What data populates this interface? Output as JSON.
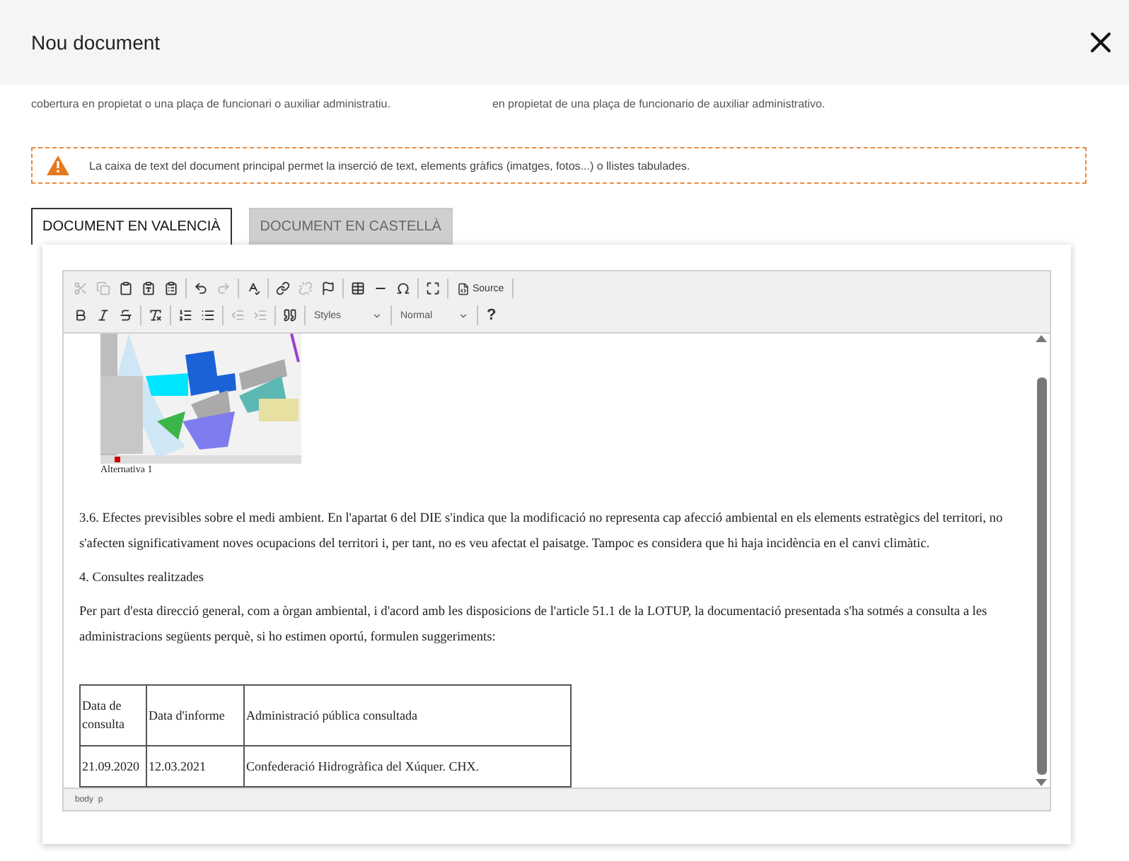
{
  "dialog": {
    "title": "Nou document"
  },
  "background_lines": [
    "cobertura en propietat o una plaça de funcionari o auxiliar administratiu.",
    "en propietat de una plaça de funcionario de auxiliar administrativo."
  ],
  "notice": "La caixa de text del document principal permet la inserció de text, elements gràfics (imatges, fotos...) o llistes tabulades.",
  "tabs": [
    {
      "label": "DOCUMENT EN VALENCIÀ",
      "selected": true
    },
    {
      "label": "DOCUMENT EN CASTELLÀ",
      "selected": false
    }
  ],
  "editor": {
    "toolbar_rows": [
      [
        {
          "kind": "icon",
          "disabled": true
        },
        {
          "kind": "icon",
          "disabled": true
        },
        {
          "kind": "icon",
          "disabled": false
        },
        {
          "kind": "icon",
          "disabled": false
        },
        {
          "kind": "icon",
          "disabled": false
        },
        {
          "kind": "sep"
        },
        {
          "kind": "icon",
          "disabled": false
        },
        {
          "kind": "icon",
          "disabled": true
        },
        {
          "kind": "sep"
        },
        {
          "kind": "icon",
          "disabled": false
        },
        {
          "kind": "sep"
        },
        {
          "kind": "icon",
          "disabled": false
        },
        {
          "kind": "icon",
          "disabled": true
        },
        {
          "kind": "icon",
          "disabled": false
        },
        {
          "kind": "sep"
        },
        {
          "kind": "icon",
          "disabled": false
        },
        {
          "kind": "icon",
          "disabled": false
        },
        {
          "kind": "icon",
          "disabled": false
        },
        {
          "kind": "sep"
        },
        {
          "kind": "icon",
          "disabled": false
        },
        {
          "kind": "sep"
        },
        {
          "kind": "source",
          "label": "Source"
        },
        {
          "kind": "sep"
        }
      ],
      [
        {
          "kind": "icon",
          "disabled": false
        },
        {
          "kind": "icon",
          "disabled": false
        },
        {
          "kind": "icon",
          "disabled": false
        },
        {
          "kind": "sep"
        },
        {
          "kind": "icon",
          "disabled": false
        },
        {
          "kind": "sep"
        },
        {
          "kind": "icon",
          "disabled": false
        },
        {
          "kind": "icon",
          "disabled": false
        },
        {
          "kind": "sep"
        },
        {
          "kind": "icon",
          "disabled": true
        },
        {
          "kind": "icon",
          "disabled": true
        },
        {
          "kind": "sep"
        },
        {
          "kind": "icon",
          "disabled": false
        },
        {
          "kind": "sep"
        },
        {
          "kind": "combo",
          "label": "Styles"
        },
        {
          "kind": "sep"
        },
        {
          "kind": "combo",
          "label": "Normal"
        },
        {
          "kind": "sep"
        },
        {
          "kind": "help",
          "label": "?"
        }
      ]
    ],
    "figure_caption": "Alternativa 1",
    "blocks": [
      {
        "kind": "paragraph",
        "text": "3.6. Efectes previsibles sobre el medi ambient. En l'apartat 6 del DIE s'indica que la modificació no representa cap afecció ambiental en els elements estratègics del territori, no s'afecten significativament noves ocupacions del territori i, per tant, no es veu afectat el paisatge. Tampoc es considera que hi haja incidència en el canvi climàtic."
      },
      {
        "kind": "paragraph",
        "text": "4. Consultes realitzades"
      },
      {
        "kind": "paragraph",
        "text": "Per part d'esta direcció general, com a òrgan ambiental, i d'acord amb les disposicions de l'article 51.1 de la LOTUP, la documentació presentada s'ha sotmés a consulta a les administracions següents perquè, si ho estimen oportú, formulen suggeriments:"
      }
    ],
    "table": {
      "columns": [
        "Data de consulta",
        "Data d'informe",
        "Administració pública consultada"
      ],
      "rows": [
        [
          "21.09.2020",
          "12.03.2021",
          "Confederació Hidrogràfica del Xúquer. CHX."
        ]
      ]
    },
    "status_path": "body  p"
  }
}
